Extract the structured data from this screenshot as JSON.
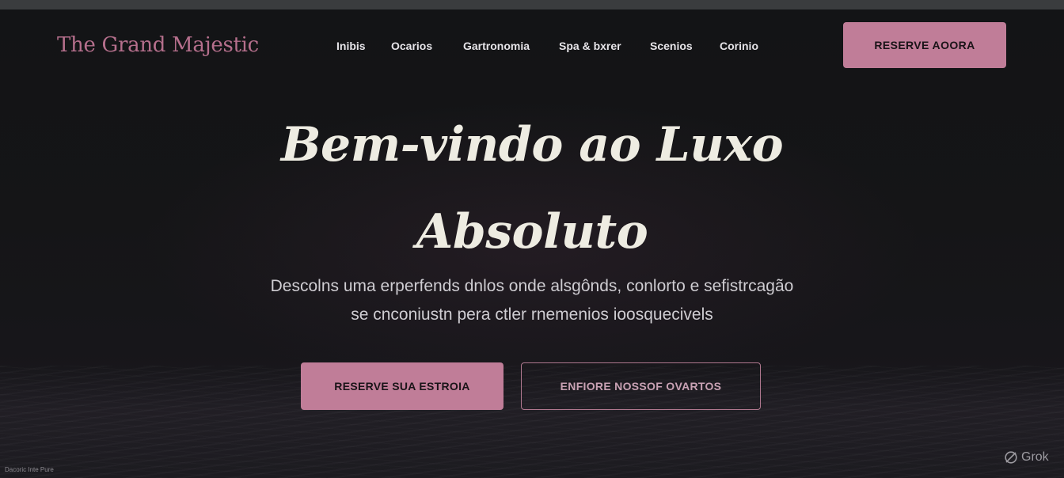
{
  "header": {
    "logo": "The Grand Majestic",
    "nav": [
      "Inibis",
      "Ocarios",
      "Gartronomia",
      "Spa & bxrer",
      "Scenios",
      "Corinio"
    ],
    "cta": "RESERVE AOORA"
  },
  "hero": {
    "headline_line1": "Bem-vindo ao Luxo",
    "headline_line2": "Absoluto",
    "subtitle_line1": "Descolns uma erperfends dnlos onde alsgônds, conlorto e sefistrcagão",
    "subtitle_line2": "se cnconiustn pera ctler rnemenios ioosquecivels",
    "primary_button": "RESERVE SUA ESTROIA",
    "secondary_button": "ENFIORE NOSSOF OVARTOS"
  },
  "footer": {
    "footnote": "Dacoric Inte  Pure"
  },
  "watermark": {
    "label": "Grok",
    "icon": "grok-logo-icon"
  },
  "colors": {
    "accent": "#c07d98",
    "background": "#141416",
    "headline": "#eeece2"
  }
}
